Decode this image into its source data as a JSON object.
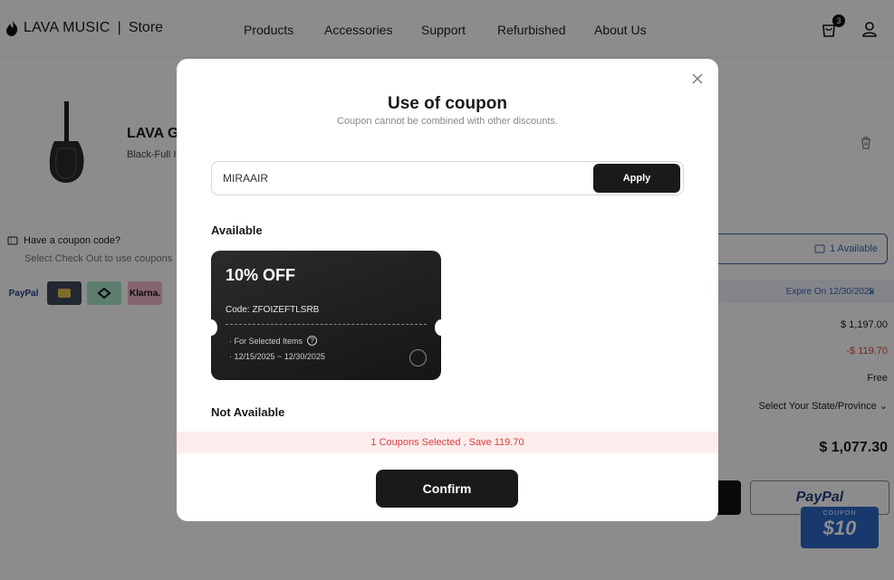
{
  "header": {
    "brand": "LAVA MUSIC",
    "separator": "|",
    "section": "Store",
    "nav": [
      "Products",
      "Accessories",
      "Support",
      "Refurbished",
      "About Us"
    ],
    "cart_count": "3"
  },
  "product": {
    "title": "LAVA G",
    "variant": "Black-Full I"
  },
  "coupon_prompt": {
    "question": "Have a coupon code?",
    "hint": "Select Check Out to use coupons"
  },
  "payment_logos": [
    "PayPal",
    "card",
    "Afterpay",
    "Klarna."
  ],
  "summary": {
    "available_label": "1 Available",
    "expire_text": "Expire On 12/30/2025",
    "subtotal": "$ 1,197.00",
    "discount": "-$ 119.70",
    "shipping": "Free",
    "state_select": "Select Your State/Province",
    "total": "$ 1,077.30",
    "paypal": "PayPal",
    "promo_top": "COUPON",
    "promo_amount": "$10"
  },
  "modal": {
    "title": "Use of coupon",
    "subtitle": "Coupon cannot be combined with other discounts.",
    "code_value": "MIRAAIR",
    "apply_label": "Apply",
    "available_heading": "Available",
    "not_available_heading": "Not Available",
    "coupons": [
      {
        "discount": "10% OFF",
        "code": "Code: ZFOIZEFTLSRB",
        "scope": "· For Selected Items",
        "help": "?",
        "dates": "· 12/15/2025 ~ 12/30/2025"
      }
    ],
    "selected_text": "1 Coupons Selected , Save 119.70",
    "confirm_label": "Confirm"
  },
  "colors": {
    "accent_blue": "#3f64b5",
    "discount_red": "#d9413f",
    "dark": "#1a1a1a",
    "coupon_card": "#1e1e1e"
  }
}
